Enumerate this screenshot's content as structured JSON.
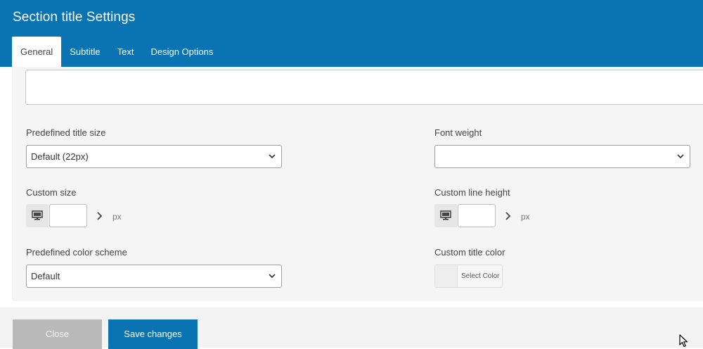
{
  "window": {
    "title": "Section title Settings"
  },
  "tabs": [
    {
      "label": "General",
      "active": true
    },
    {
      "label": "Subtitle",
      "active": false
    },
    {
      "label": "Text",
      "active": false
    },
    {
      "label": "Design Options",
      "active": false
    }
  ],
  "fields": {
    "predefined_title_size": {
      "label": "Predefined title size",
      "value": "Default (22px)"
    },
    "font_weight": {
      "label": "Font weight",
      "value": ""
    },
    "custom_size": {
      "label": "Custom size",
      "value": "",
      "unit": "px",
      "device_icon": "desktop-icon"
    },
    "custom_line_height": {
      "label": "Custom line height",
      "value": "",
      "unit": "px",
      "device_icon": "desktop-icon"
    },
    "predefined_color_scheme": {
      "label": "Predefined color scheme",
      "value": "Default"
    },
    "custom_title_color": {
      "label": "Custom title color",
      "button_label": "Select Color"
    }
  },
  "footer": {
    "close_label": "Close",
    "save_label": "Save changes"
  },
  "colors": {
    "accent": "#0a73b1",
    "close_button": "#b9b9b9",
    "panel_bg": "#f5f5f5"
  }
}
